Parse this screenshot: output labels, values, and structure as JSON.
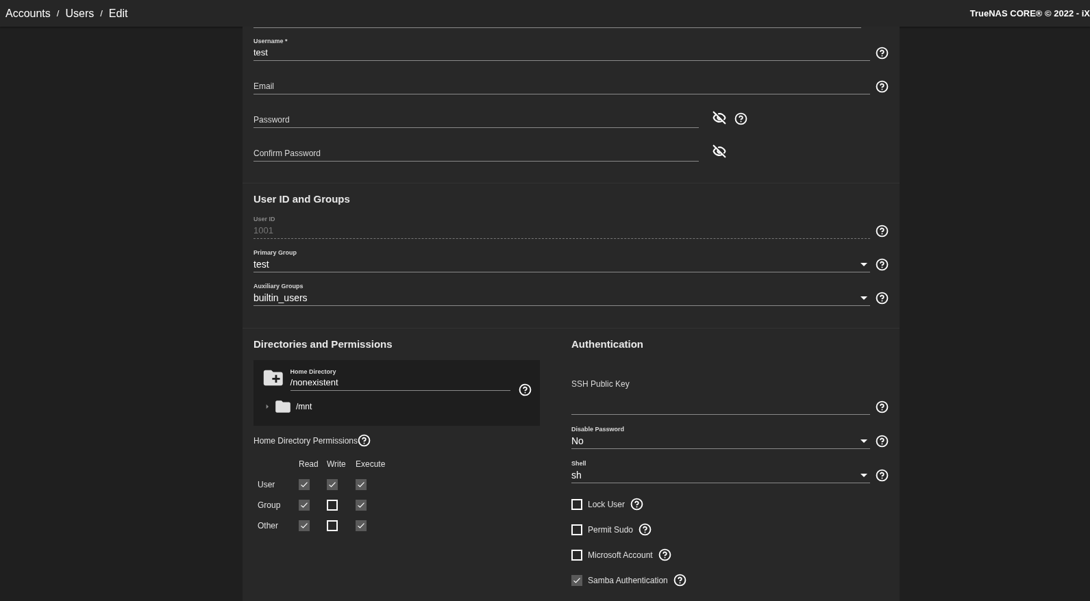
{
  "header": {
    "breadcrumbs": [
      "Accounts",
      "Users",
      "Edit"
    ],
    "separator": "/",
    "product": "TrueNAS CORE® © 2022 - iX"
  },
  "identification": {
    "fields": [
      {
        "kind": "text",
        "label": "Username *",
        "value": "test",
        "help": true
      },
      {
        "kind": "text",
        "placeholder": "Email",
        "help": true
      },
      {
        "kind": "password",
        "placeholder": "Password",
        "help": true
      },
      {
        "kind": "password",
        "placeholder": "Confirm Password",
        "help": false
      }
    ]
  },
  "user_id_and_groups": {
    "title": "User ID and Groups",
    "fields": [
      {
        "kind": "text",
        "label": "User ID",
        "value": "1001",
        "disabled": true,
        "help": true
      },
      {
        "kind": "select",
        "label": "Primary Group",
        "value": "test",
        "disabled": false,
        "help": true
      },
      {
        "kind": "select",
        "label": "Auxiliary Groups",
        "value": "builtin_users",
        "disabled": false,
        "help": true
      }
    ]
  },
  "directories": {
    "title": "Directories and Permissions",
    "home_directory": {
      "label": "Home Directory",
      "value": "/nonexistent",
      "tree": [
        {
          "name": "/mnt",
          "expanded": false
        }
      ]
    },
    "permissions": {
      "title": "Home Directory Permissions",
      "columns": [
        "Read",
        "Write",
        "Execute"
      ],
      "rows": [
        {
          "label": "User",
          "checked": [
            true,
            true,
            true
          ]
        },
        {
          "label": "Group",
          "checked": [
            true,
            false,
            true
          ]
        },
        {
          "label": "Other",
          "checked": [
            true,
            false,
            true
          ]
        }
      ]
    }
  },
  "authentication": {
    "title": "Authentication",
    "fields": [
      {
        "kind": "textarea",
        "label": "SSH Public Key",
        "help": true
      },
      {
        "kind": "select",
        "label": "Disable Password",
        "value": "No",
        "help": true
      },
      {
        "kind": "select",
        "label": "Shell",
        "value": "sh",
        "help": true
      }
    ],
    "checkboxes": [
      {
        "label": "Lock User",
        "checked": false
      },
      {
        "label": "Permit Sudo",
        "checked": false
      },
      {
        "label": "Microsoft Account",
        "checked": false
      },
      {
        "label": "Samba Authentication",
        "checked": true
      }
    ]
  }
}
